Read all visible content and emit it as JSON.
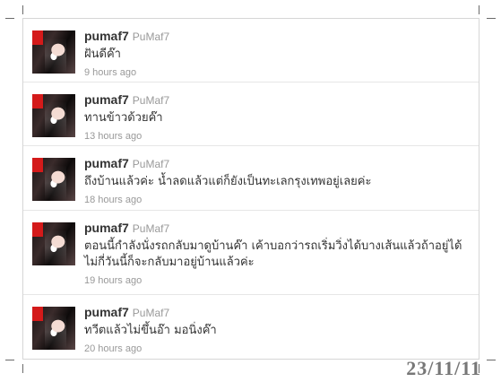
{
  "tweets": [
    {
      "username": "pumaf7",
      "fullname": "PuMaf7 ",
      "text": "ฝันดีค๊า",
      "time": "9 hours ago"
    },
    {
      "username": "pumaf7",
      "fullname": "PuMaf7 ",
      "text": "ทานข้าวด้วยค๊า",
      "time": "13 hours ago"
    },
    {
      "username": "pumaf7",
      "fullname": "PuMaf7 ",
      "text": "ถึงบ้านแล้วค่ะ น้ำลดแล้วแต่ก็ยังเป็นทะเลกรุงเทพอยู่เลยค่ะ",
      "time": "18 hours ago"
    },
    {
      "username": "pumaf7",
      "fullname": "PuMaf7 ",
      "text": "ตอนนี้กำลังนั่งรถกลับมาดูบ้านค๊า เค้าบอกว่ารถเริ่มวิ่งได้บางเส้นแล้วถ้าอยู่ได้ ไม่กี่วันนี้ก็จะกลับมาอยู่บ้านแล้วค่ะ",
      "time": "19 hours ago"
    },
    {
      "username": "pumaf7",
      "fullname": "PuMaf7 ",
      "text": "ทวีตแล้วไม่ขึ้นอ๊า มอนิ่งค๊า",
      "time": "20 hours ago"
    }
  ],
  "date_stamp": "23/11/11"
}
